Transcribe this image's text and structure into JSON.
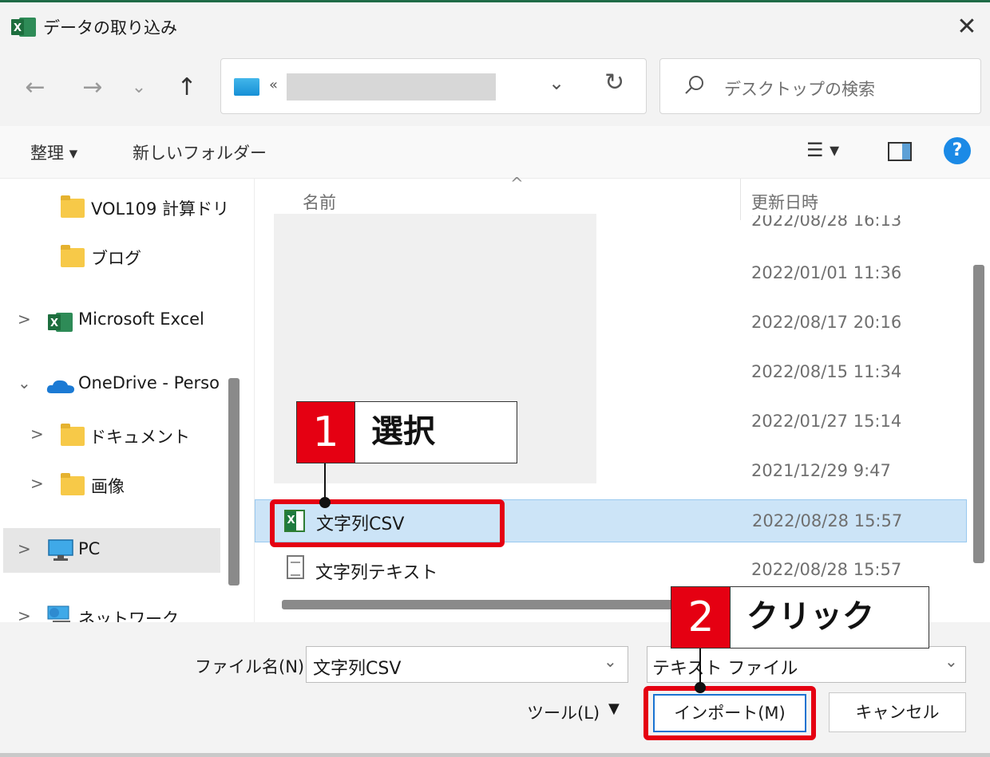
{
  "window": {
    "title": "データの取り込み",
    "close_glyph": "✕"
  },
  "nav": {
    "back_glyph": "←",
    "forward_glyph": "→",
    "recent_glyph": "⌄",
    "up_glyph": "↑",
    "address_chevrons": "«",
    "address_dropdown_glyph": "⌄",
    "refresh_glyph": "↻",
    "search_placeholder": "デスクトップの検索"
  },
  "toolbar": {
    "organize_label": "整理 ▾",
    "new_folder_label": "新しいフォルダー",
    "view_glyph": "☰ ▾",
    "help_glyph": "?"
  },
  "sidebar": {
    "items": [
      {
        "label": "VOL109 計算ドリ",
        "icon": "folder-icon"
      },
      {
        "label": "ブログ",
        "icon": "folder-icon"
      },
      {
        "label": "Microsoft Excel",
        "icon": "excel-icon",
        "chev": ">"
      },
      {
        "label": "OneDrive - Perso",
        "icon": "cloud-icon",
        "chev": "⌄"
      },
      {
        "label": "ドキュメント",
        "icon": "folder-icon",
        "chev": ">"
      },
      {
        "label": "画像",
        "icon": "folder-icon",
        "chev": ">"
      },
      {
        "label": "PC",
        "icon": "monitor-icon",
        "chev": ">"
      },
      {
        "label": "ネットワーク",
        "icon": "network-icon",
        "chev": ">"
      }
    ]
  },
  "filelist": {
    "col_name": "名前",
    "col_date": "更新日時",
    "sort_glyph": "^",
    "hidden_dates": [
      "2022/08/28 16:13",
      "2022/01/01 11:36",
      "2022/08/17 20:16",
      "2022/08/15 11:34",
      "2022/01/27 15:14",
      "2021/12/29 9:47"
    ],
    "rows": [
      {
        "name": "文字列CSV",
        "date": "2022/08/28 15:57",
        "selected": true,
        "icon": "csv-icon"
      },
      {
        "name": "文字列テキスト",
        "date": "2022/08/28 15:57",
        "selected": false,
        "icon": "text-file-icon"
      }
    ]
  },
  "footer": {
    "filename_label": "ファイル名(N):",
    "filename_value": "文字列CSV",
    "filetype_value": "テキスト ファイル",
    "dropdown_glyph": "⌄",
    "tools_label": "ツール(L)",
    "tools_arrow": "▼",
    "import_label": "インポート(M)",
    "cancel_label": "キャンセル"
  },
  "annotations": {
    "step1": {
      "number": "1",
      "text": "選択"
    },
    "step2": {
      "number": "2",
      "text": "クリック"
    }
  },
  "colors": {
    "accent_red": "#e50012",
    "selection_blue": "#cce4f7",
    "excel_green": "#1f7a3f"
  }
}
